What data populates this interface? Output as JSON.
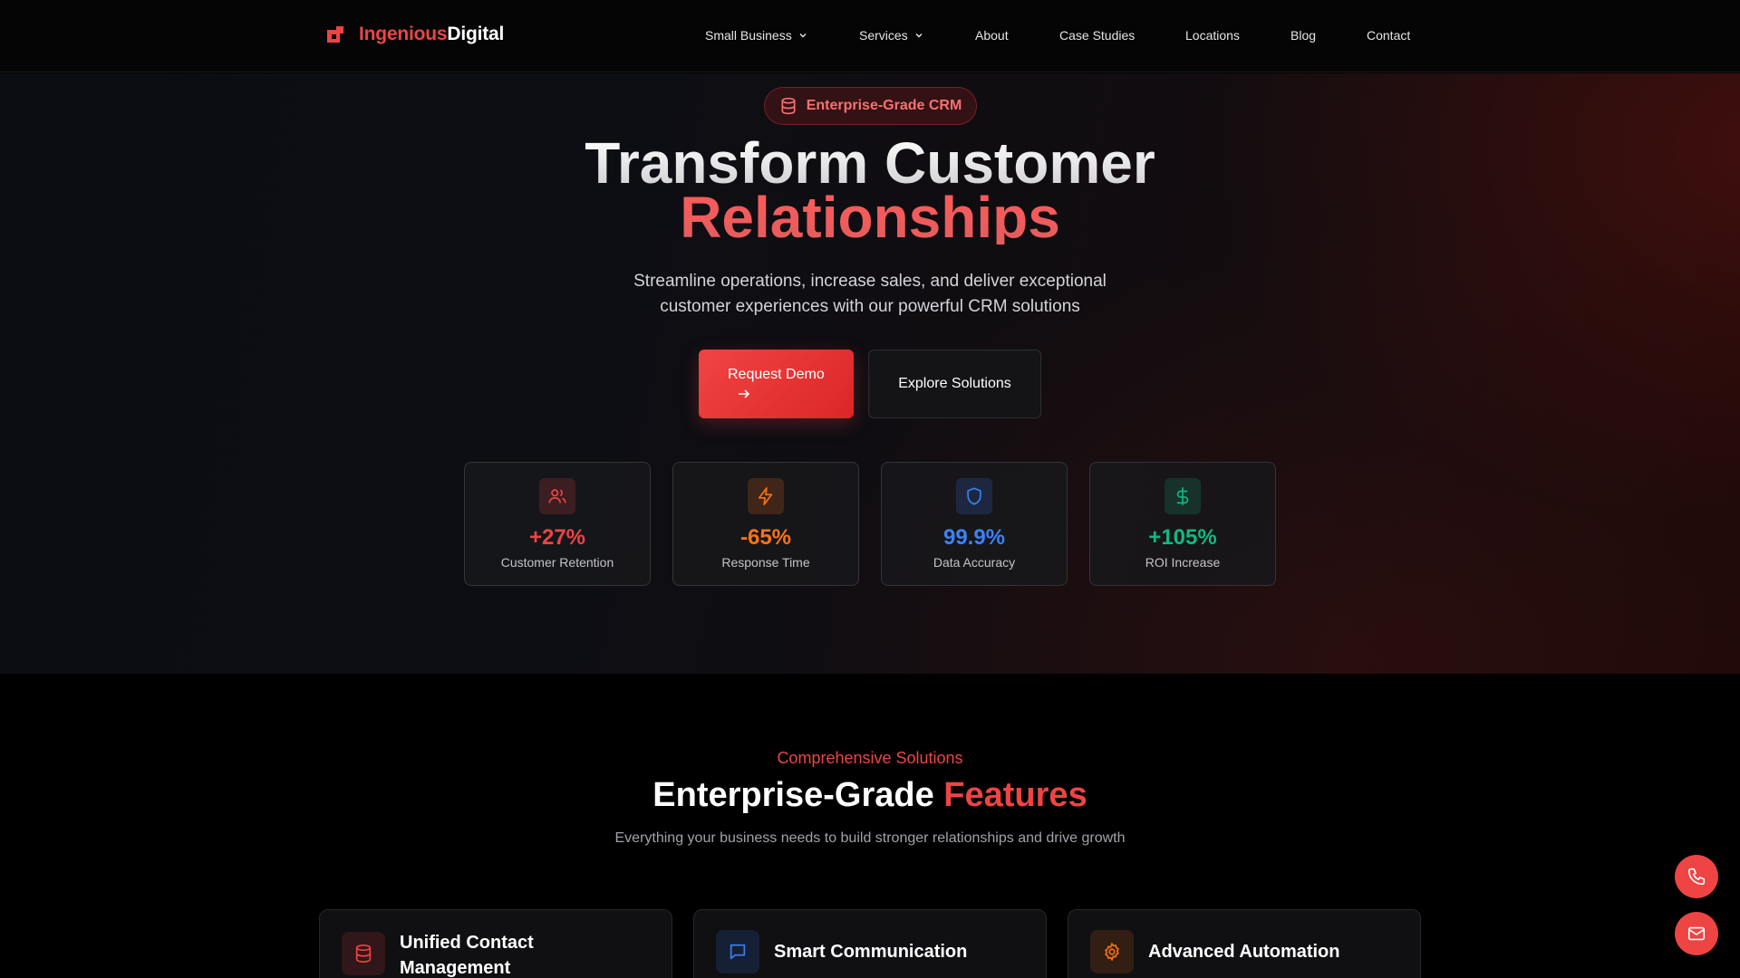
{
  "brand": {
    "name_part1": "Ingenious",
    "name_part2": "Digital"
  },
  "nav": {
    "items": [
      {
        "label": "Small Business",
        "dropdown": true
      },
      {
        "label": "Services",
        "dropdown": true
      },
      {
        "label": "About"
      },
      {
        "label": "Case Studies"
      },
      {
        "label": "Locations"
      },
      {
        "label": "Blog"
      },
      {
        "label": "Contact"
      }
    ]
  },
  "hero": {
    "badge": "Enterprise-Grade CRM",
    "title_line1": "Transform Customer",
    "title_line2": "Relationships",
    "subtitle": "Streamline operations, increase sales, and deliver exceptional customer experiences with our powerful CRM solutions",
    "primary_button": "Request Demo",
    "secondary_button": "Explore Solutions"
  },
  "stats": [
    {
      "icon": "users-icon",
      "value": "+27%",
      "label": "Customer Retention",
      "color": "#ef4444"
    },
    {
      "icon": "lightning-icon",
      "value": "-65%",
      "label": "Response Time",
      "color": "#f97316"
    },
    {
      "icon": "shield-icon",
      "value": "99.9%",
      "label": "Data Accuracy",
      "color": "#3b82f6"
    },
    {
      "icon": "dollar-icon",
      "value": "+105%",
      "label": "ROI Increase",
      "color": "#10b981"
    }
  ],
  "features": {
    "eyebrow": "Comprehensive Solutions",
    "title_part1": "Enterprise-Grade",
    "title_part2": "Features",
    "subtitle": "Everything your business needs to build stronger relationships and drive growth",
    "cards": [
      {
        "icon": "database-icon",
        "title_line1": "Unified Contact",
        "title_line2": "Management",
        "color": "#ef4444"
      },
      {
        "icon": "chat-icon",
        "title_line1": "Smart Communication",
        "color": "#3b82f6"
      },
      {
        "icon": "gear-icon",
        "title_line1": "Advanced Automation",
        "color": "#f97316"
      }
    ]
  },
  "colors": {
    "accent": "#ef4444",
    "background": "#000000"
  }
}
